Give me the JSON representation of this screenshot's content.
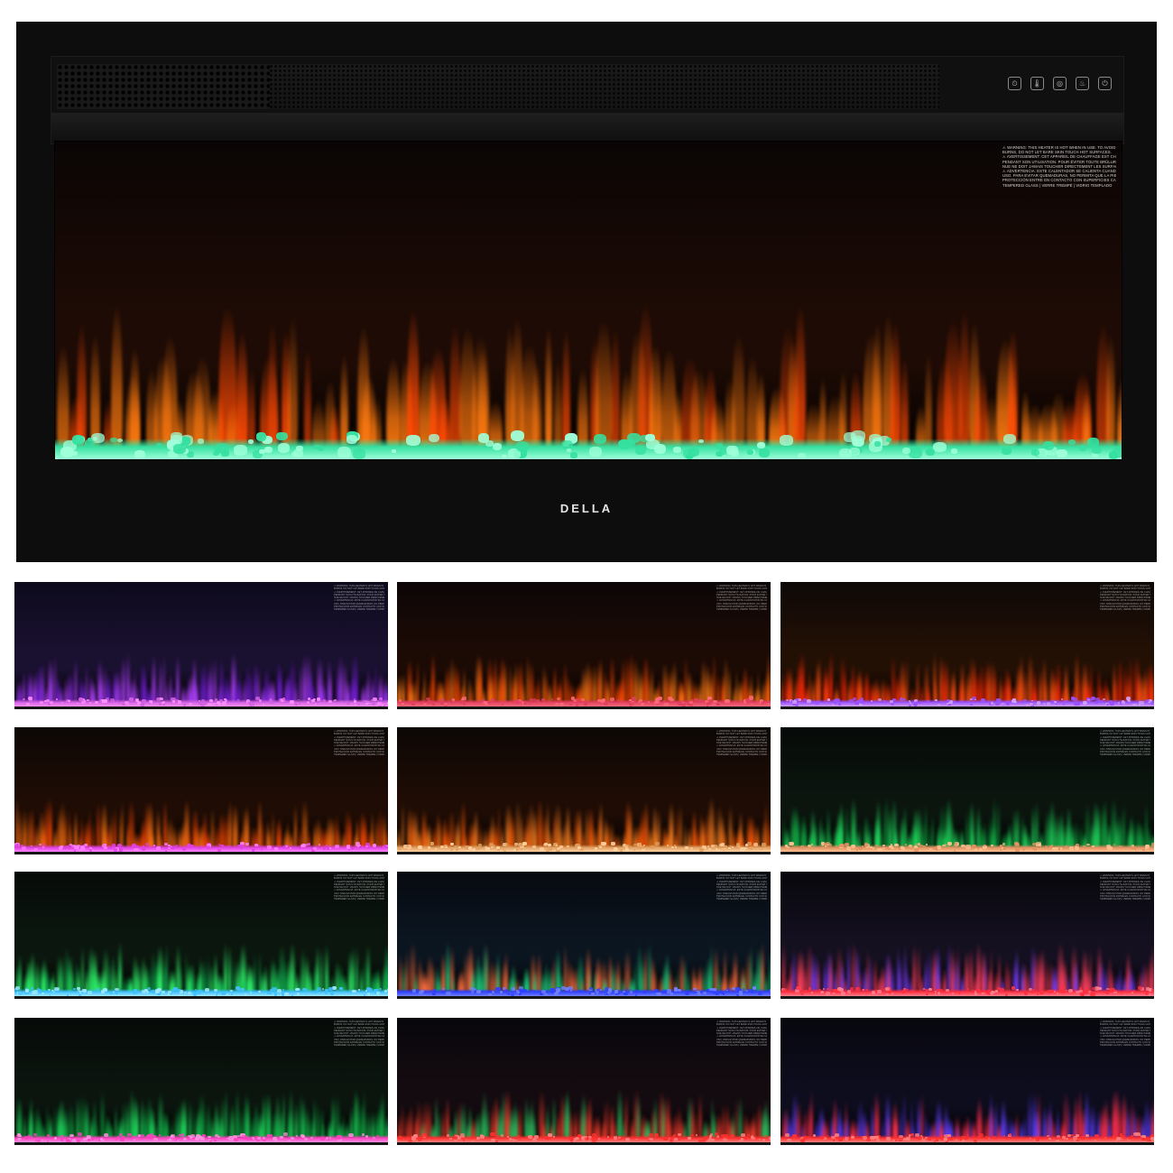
{
  "brand": "DELLA",
  "controls": [
    {
      "icon": "timer-icon",
      "glyph": "⏲"
    },
    {
      "icon": "thermometer-icon",
      "glyph": "🌡"
    },
    {
      "icon": "flame-color-icon",
      "glyph": "◎"
    },
    {
      "icon": "flame-icon",
      "glyph": "♨"
    },
    {
      "icon": "power-icon",
      "glyph": "⏻"
    }
  ],
  "warning_label": [
    "⚠ WARNING: THIS HEATER IS HOT WHEN IN USE. TO AVOID",
    "BURNS, DO NOT LET BARE SKIN TOUCH HOT SURFACES.",
    "⚠ AVERTISSEMENT: CET APPAREIL DE CHAUFFAGE EST CHAUD",
    "PENDANT SON UTILISATION. POUR ÉVITER TOUTE BRÛLURE, LA PEAU",
    "NUE NE DOIT JAMAIS TOUCHER DIRECTEMENT LES SURFACES.",
    "⚠ ADVERTENCIA: ESTE CALENTADOR SE CALIENTA CUANDO ESTÁ EN",
    "USO. PARA EVITAR QUEMADURAS, NO PERMITA QUE LA PIEL SIN",
    "PROTECCIÓN ENTRE EN CONTACTO CON SUPERFICIES CALIENTES.",
    "TEMPERED GLASS | VERRE TREMPÉ | VIDRIO TEMPLADO"
  ],
  "colors": {
    "frame": "#0d0d0d",
    "background": "#ffffff"
  },
  "main_preset": {
    "bg_top": "#0a0505",
    "bg_mid": "#1e0b05",
    "flame_a": "#ff7a10",
    "flame_b": "#ff4a05",
    "ember": "#35e0a0",
    "ember_glow": "#9fffd8"
  },
  "presets": [
    {
      "bg_top": "#0d0a1c",
      "bg_mid": "#1a1030",
      "flame_a": "#b040ff",
      "flame_b": "#7a20e0",
      "ember": "#d060e0",
      "ember_glow": "#ff90ff"
    },
    {
      "bg_top": "#0c0606",
      "bg_mid": "#1c0a05",
      "flame_a": "#ff7a15",
      "flame_b": "#ff4a05",
      "ember": "#e04060",
      "ember_glow": "#ff6a7a"
    },
    {
      "bg_top": "#0d0806",
      "bg_mid": "#231005",
      "flame_a": "#ff5010",
      "flame_b": "#ff2a05",
      "ember": "#9a50ff",
      "ember_glow": "#d0a0ff"
    },
    {
      "bg_top": "#0c0705",
      "bg_mid": "#1e0c05",
      "flame_a": "#ff7012",
      "flame_b": "#ff4a05",
      "ember": "#e040e0",
      "ember_glow": "#ff80ff"
    },
    {
      "bg_top": "#0c0705",
      "bg_mid": "#1e0c05",
      "flame_a": "#ff8020",
      "flame_b": "#ff5a08",
      "ember": "#e0a060",
      "ember_glow": "#ffd0a0"
    },
    {
      "bg_top": "#060a08",
      "bg_mid": "#0b150e",
      "flame_a": "#20e060",
      "flame_b": "#10a040",
      "ember": "#e09060",
      "ember_glow": "#ffc090"
    },
    {
      "bg_top": "#060a08",
      "bg_mid": "#0b170e",
      "flame_a": "#30ff70",
      "flame_b": "#10b050",
      "ember": "#40c0ff",
      "ember_glow": "#a0e8ff"
    },
    {
      "bg_top": "#070a10",
      "bg_mid": "#0b1520",
      "flame_a": "#ff7040",
      "flame_b": "#20d080",
      "ember": "#3040ff",
      "ember_glow": "#7080ff"
    },
    {
      "bg_top": "#08070c",
      "bg_mid": "#141020",
      "flame_a": "#ff4060",
      "flame_b": "#8040ff",
      "ember": "#ff3040",
      "ember_glow": "#ff8090"
    },
    {
      "bg_top": "#060a08",
      "bg_mid": "#0b150e",
      "flame_a": "#20e060",
      "flame_b": "#10a040",
      "ember": "#ff40c0",
      "ember_glow": "#ff90e0"
    },
    {
      "bg_top": "#08070c",
      "bg_mid": "#140b10",
      "flame_a": "#ff4030",
      "flame_b": "#30c060",
      "ember": "#ff3030",
      "ember_glow": "#ff8080"
    },
    {
      "bg_top": "#07070e",
      "bg_mid": "#0e0d1e",
      "flame_a": "#6040ff",
      "flame_b": "#ff3050",
      "ember": "#ff3030",
      "ember_glow": "#ff8080"
    }
  ]
}
